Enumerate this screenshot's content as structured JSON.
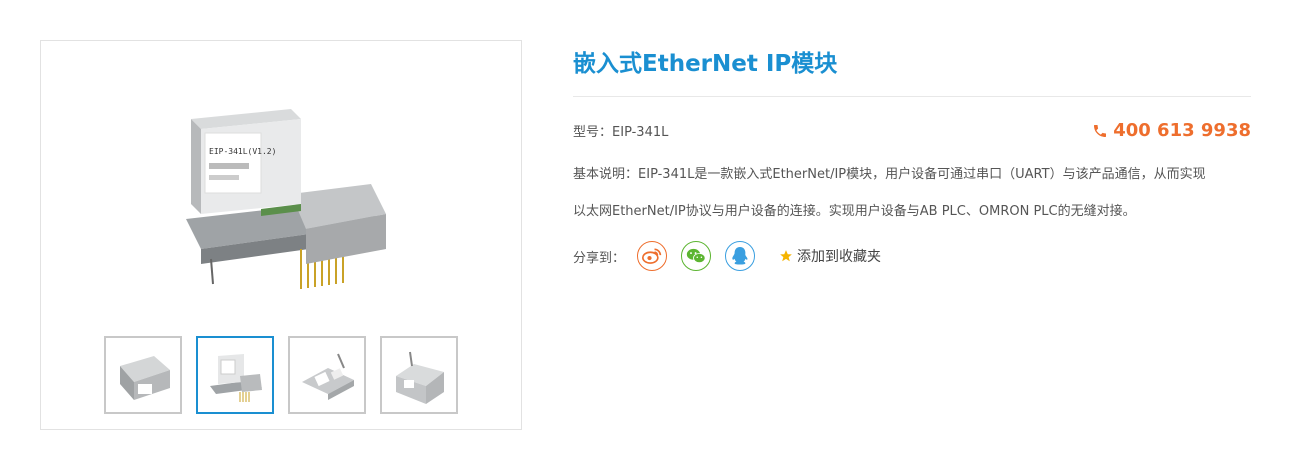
{
  "product": {
    "title": "嵌入式EtherNet IP模块",
    "model_label": "型号：",
    "model_value": "EIP-341L",
    "phone": "400 613 9938",
    "description_label": "基本说明：",
    "description_line1": "EIP-341L是一款嵌入式EtherNet/IP模块，用户设备可通过串口（UART）与该产品通信，从而实现",
    "description_line2": "以太网EtherNet/IP协议与用户设备的连接。实现用户设备与AB PLC、OMRON PLC的无缝对接。"
  },
  "share": {
    "label": "分享到：",
    "icons": [
      "weibo-icon",
      "wechat-icon",
      "qq-icon"
    ],
    "favorite_label": "添加到收藏夹"
  },
  "module_label": "EIP-341L(V1.2)",
  "gallery": {
    "active_index": 1,
    "thumbnail_count": 4
  },
  "colors": {
    "title": "#1a8fd1",
    "phone": "#ee6e2d",
    "weibo": "#ee6e2d",
    "wechat": "#5cb531",
    "qq": "#3a9fe0",
    "star": "#f5b400",
    "active_thumb": "#1a8fd1"
  }
}
